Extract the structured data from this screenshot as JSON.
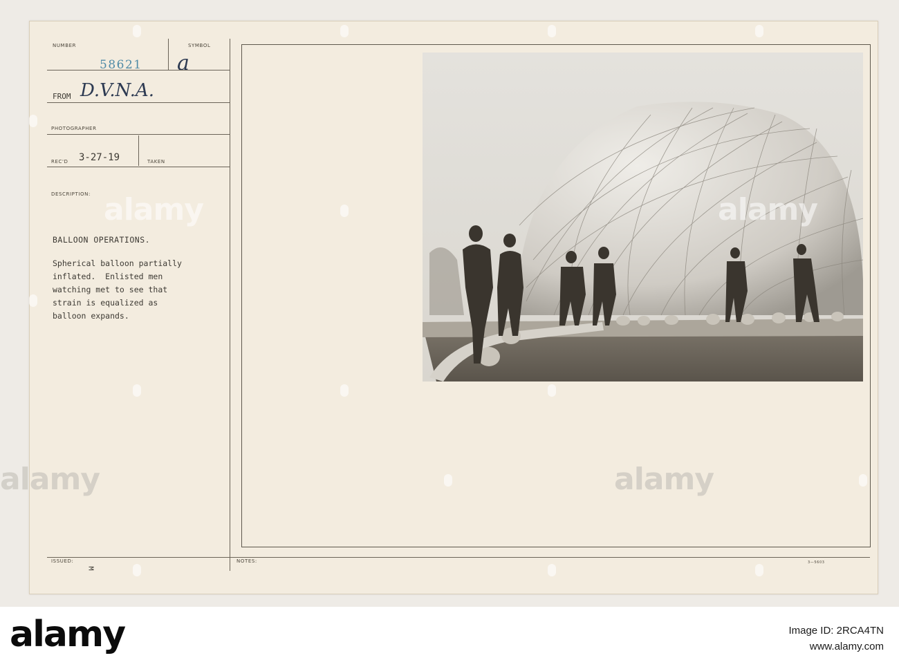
{
  "card": {
    "number_label": "NUMBER",
    "number_value": "58621",
    "symbol_label": "SYMBOL",
    "symbol_value": "a",
    "from_label": "FROM",
    "from_value": "D.V.N.A.",
    "photographer_label": "PHOTOGRAPHER",
    "recd_label": "REC'D",
    "recd_value": "3-27-19",
    "taken_label": "TAKEN",
    "description_label": "DESCRIPTION:",
    "title": "BALLOON OPERATIONS.",
    "description_lines": [
      "Spherical balloon partially",
      "inflated.  Enlisted men",
      "watching met to see that",
      "strain is equalized as",
      "balloon expands."
    ],
    "issued_label": "ISSUED:",
    "issued_mark": "M",
    "notes_label": "NOTES:",
    "form_code": "3—5603"
  },
  "watermark": {
    "text": "alamy"
  },
  "footer": {
    "logo": "alamy",
    "image_id": "Image ID: 2RCA4TN",
    "url": "www.alamy.com"
  },
  "colors": {
    "card_bg": "#f3ecdf",
    "stamp_blue": "#4f8aa6",
    "ink": "#2d3a52"
  }
}
